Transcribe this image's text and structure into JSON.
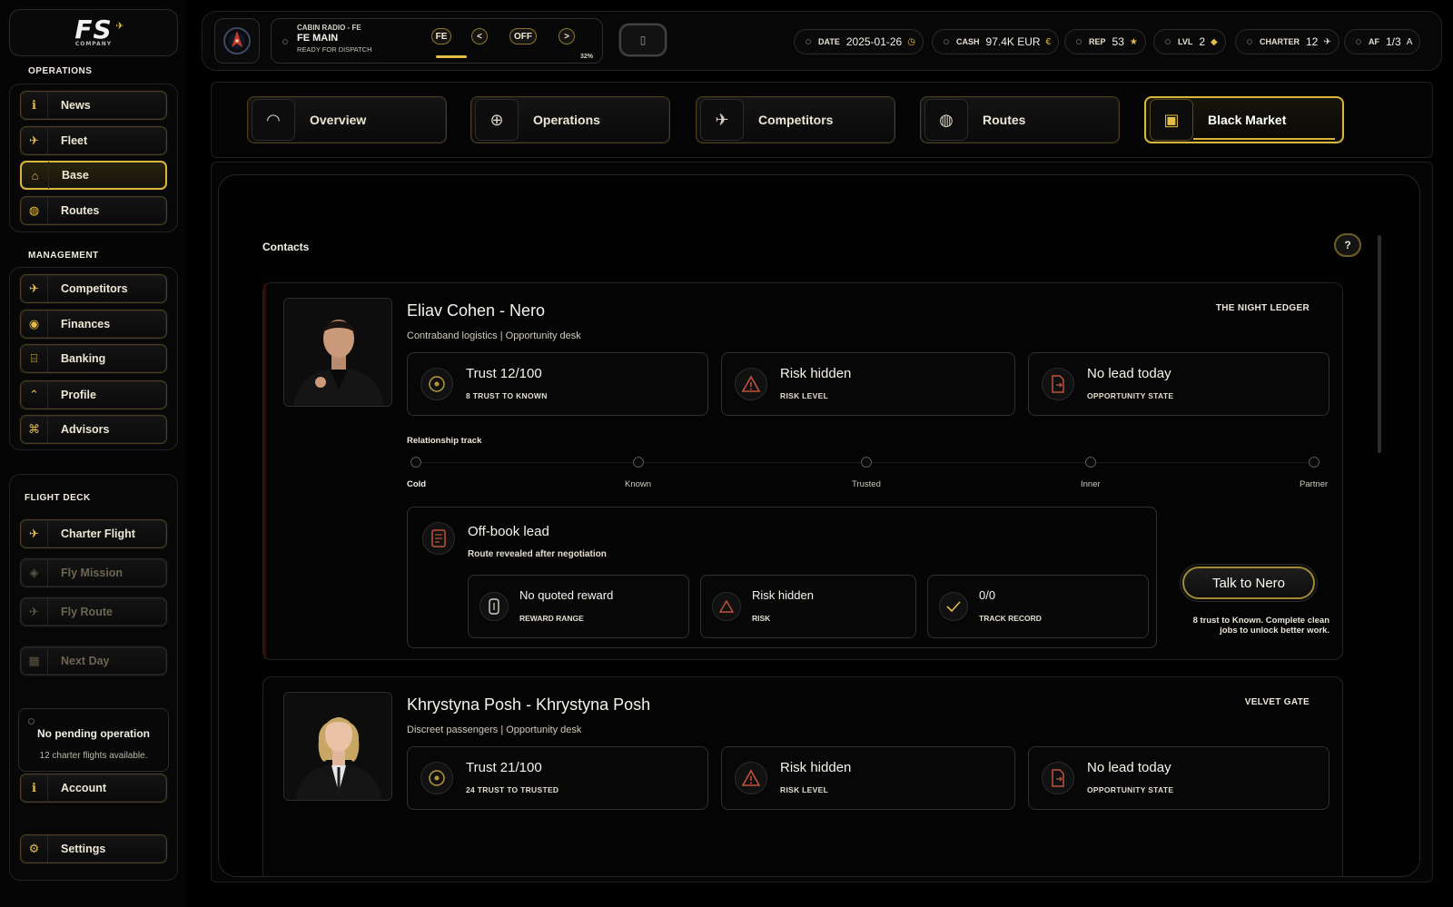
{
  "logo": {
    "text": "FS",
    "sub": "COMPANY"
  },
  "sidebar": {
    "operations_label": "OPERATIONS",
    "operations": [
      {
        "label": "News",
        "icon": "info-icon"
      },
      {
        "label": "Fleet",
        "icon": "plane-icon"
      },
      {
        "label": "Base",
        "icon": "hangar-icon",
        "active": true
      },
      {
        "label": "Routes",
        "icon": "globe-icon"
      }
    ],
    "management_label": "MANAGEMENT",
    "management": [
      {
        "label": "Competitors",
        "icon": "jets-icon"
      },
      {
        "label": "Finances",
        "icon": "coins-icon"
      },
      {
        "label": "Banking",
        "icon": "bank-icon"
      },
      {
        "label": "Profile",
        "icon": "pilot-icon"
      },
      {
        "label": "Advisors",
        "icon": "advisor-icon"
      }
    ],
    "flightdeck_label": "FLIGHT DECK",
    "flightdeck": [
      {
        "label": "Charter Flight",
        "icon": "plane-icon",
        "disabled": false
      },
      {
        "label": "Fly Mission",
        "icon": "target-icon",
        "disabled": true
      },
      {
        "label": "Fly Route",
        "icon": "plane-icon",
        "disabled": true
      },
      {
        "label": "Next Day",
        "icon": "calendar-icon",
        "disabled": true
      }
    ],
    "pending": {
      "title": "No pending operation",
      "detail": "12 charter flights available."
    },
    "account_label": "Account",
    "settings_label": "Settings"
  },
  "topbar": {
    "radio": {
      "line1": "CABIN RADIO - FE",
      "line2": "FE MAIN",
      "line3": "READY FOR DISPATCH",
      "btn_fe": "FE",
      "btn_prev": "<",
      "btn_off": "OFF",
      "btn_next": ">",
      "percent": "32%"
    },
    "stats": [
      {
        "key": "DATE",
        "value": "2025-01-26",
        "sym": "◷"
      },
      {
        "key": "CASH",
        "value": "97.4K EUR",
        "sym": "€"
      },
      {
        "key": "REP",
        "value": "53",
        "sym": "★"
      },
      {
        "key": "LVL",
        "value": "2",
        "sym": "◆"
      },
      {
        "key": "CHARTER",
        "value": "12",
        "sym": "✈"
      },
      {
        "key": "AF",
        "value": "1/3",
        "sym": "A"
      }
    ]
  },
  "tabs": [
    {
      "label": "Overview",
      "icon": "gauge-icon"
    },
    {
      "label": "Operations",
      "icon": "crosshair-icon"
    },
    {
      "label": "Competitors",
      "icon": "jets-icon"
    },
    {
      "label": "Routes",
      "icon": "globe-icon"
    },
    {
      "label": "Black Market",
      "icon": "lockbox-icon",
      "active": true
    }
  ],
  "main": {
    "title": "Contacts",
    "help": "?",
    "relationship_label": "Relationship track",
    "stages": [
      "Cold",
      "Known",
      "Trusted",
      "Inner",
      "Partner"
    ],
    "contacts": [
      {
        "name": "Eliav Cohen - Nero",
        "tag": "THE NIGHT LEDGER",
        "subtitle": "Contraband logistics | Opportunity desk",
        "trust": {
          "value": "Trust 12/100",
          "label": "8 TRUST TO KNOWN"
        },
        "risk": {
          "value": "Risk hidden",
          "label": "RISK LEVEL"
        },
        "lead": {
          "value": "No lead today",
          "label": "OPPORTUNITY STATE"
        },
        "stage_index": 0,
        "offbook": {
          "title": "Off-book lead",
          "subtitle": "Route revealed after negotiation",
          "reward": {
            "value": "No quoted reward",
            "label": "REWARD RANGE"
          },
          "risk": {
            "value": "Risk hidden",
            "label": "RISK"
          },
          "record": {
            "value": "0/0",
            "label": "TRACK RECORD"
          }
        },
        "action": "Talk to Nero",
        "action_note": "8 trust to Known. Complete clean jobs to unlock better work."
      },
      {
        "name": "Khrystyna Posh - Khrystyna Posh",
        "tag": "VELVET GATE",
        "subtitle": "Discreet passengers | Opportunity desk",
        "trust": {
          "value": "Trust 21/100",
          "label": "24 TRUST TO TRUSTED"
        },
        "risk": {
          "value": "Risk hidden",
          "label": "RISK LEVEL"
        },
        "lead": {
          "value": "No lead today",
          "label": "OPPORTUNITY STATE"
        }
      }
    ]
  },
  "colors": {
    "accent": "#e3bd45",
    "risk": "#c0533a",
    "bg": "#000000"
  }
}
